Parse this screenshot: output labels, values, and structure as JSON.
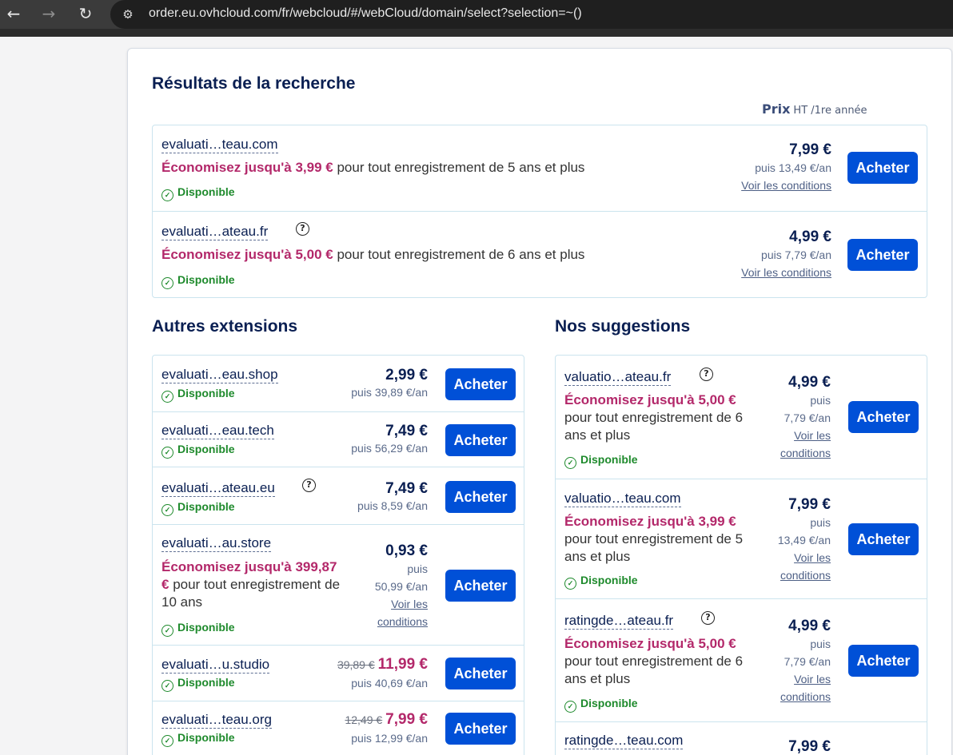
{
  "browser": {
    "url": "order.eu.ovhcloud.com/fr/webcloud/#/webCloud/domain/select?selection=~()"
  },
  "results": {
    "title": "Résultats de la recherche",
    "price_head": "Prix",
    "price_sub": "HT /1re année",
    "items": [
      {
        "domain": "evaluati…teau.com",
        "promo_pink": "Économisez jusqu'à 3,99 €",
        "promo_rest": " pour tout enregistrement de 5 ans et plus",
        "status": "Disponible",
        "price": "7,99 €",
        "then": "puis 13,49 €/an",
        "conditions": "Voir les conditions",
        "button": "Acheter"
      },
      {
        "domain": "evaluati…ateau.fr",
        "promo_pink": "Économisez jusqu'à 5,00 €",
        "promo_rest": " pour tout enregistrement de 6 ans et plus",
        "status": "Disponible",
        "price": "4,99 €",
        "then": "puis 7,79 €/an",
        "conditions": "Voir les conditions",
        "button": "Acheter"
      }
    ]
  },
  "autres": {
    "title": "Autres extensions",
    "items": [
      {
        "domain": "evaluati…eau.shop",
        "status": "Disponible",
        "price": "2,99 €",
        "then": "puis 39,89 €/an",
        "button": "Acheter"
      },
      {
        "domain": "evaluati…eau.tech",
        "status": "Disponible",
        "price": "7,49 €",
        "then": "puis 56,29 €/an",
        "button": "Acheter"
      },
      {
        "domain": "evaluati…ateau.eu",
        "status": "Disponible",
        "price": "7,49 €",
        "then": "puis 8,59 €/an",
        "button": "Acheter"
      },
      {
        "domain": "evaluati…au.store",
        "promo_pink": "Économisez jusqu'à 399,87 €",
        "promo_rest": " pour tout enregistrement de 10 ans",
        "status": "Disponible",
        "price": "0,93 €",
        "then_a": "puis",
        "then_b": "50,99 €/an",
        "cond_a": "Voir les",
        "cond_b": "conditions",
        "button": "Acheter"
      },
      {
        "domain": "evaluati…u.studio",
        "status": "Disponible",
        "old_price": "39,89 €",
        "price": "11,99 €",
        "then": "puis 40,69 €/an",
        "button": "Acheter"
      },
      {
        "domain": "evaluati…teau.org",
        "status": "Disponible",
        "old_price": "12,49 €",
        "price": "7,99 €",
        "then": "puis 12,99 €/an",
        "button": "Acheter"
      }
    ]
  },
  "suggestions": {
    "title": "Nos suggestions",
    "items": [
      {
        "domain": "valuatio…ateau.fr",
        "promo_pink": "Économisez jusqu'à 5,00 €",
        "promo_rest": "pour tout enregistrement de 6 ans et plus",
        "status": "Disponible",
        "price": "4,99 €",
        "then_a": "puis",
        "then_b": "7,79 €/an",
        "cond_a": "Voir les",
        "cond_b": "conditions",
        "button": "Acheter"
      },
      {
        "domain": "valuatio…teau.com",
        "promo_pink": "Économisez jusqu'à 3,99 €",
        "promo_rest": "pour tout enregistrement de 5 ans et plus",
        "status": "Disponible",
        "price": "7,99 €",
        "then_a": "puis",
        "then_b": "13,49 €/an",
        "cond_a": "Voir les",
        "cond_b": "conditions",
        "button": "Acheter"
      },
      {
        "domain": "ratingde…ateau.fr",
        "promo_pink": "Économisez jusqu'à 5,00 €",
        "promo_rest": "pour tout enregistrement de 6 ans et plus",
        "status": "Disponible",
        "price": "4,99 €",
        "then_a": "puis",
        "then_b": "7,79 €/an",
        "cond_a": "Voir les",
        "cond_b": "conditions",
        "button": "Acheter"
      },
      {
        "domain": "ratingde…teau.com",
        "price": "7,99 €"
      }
    ]
  }
}
